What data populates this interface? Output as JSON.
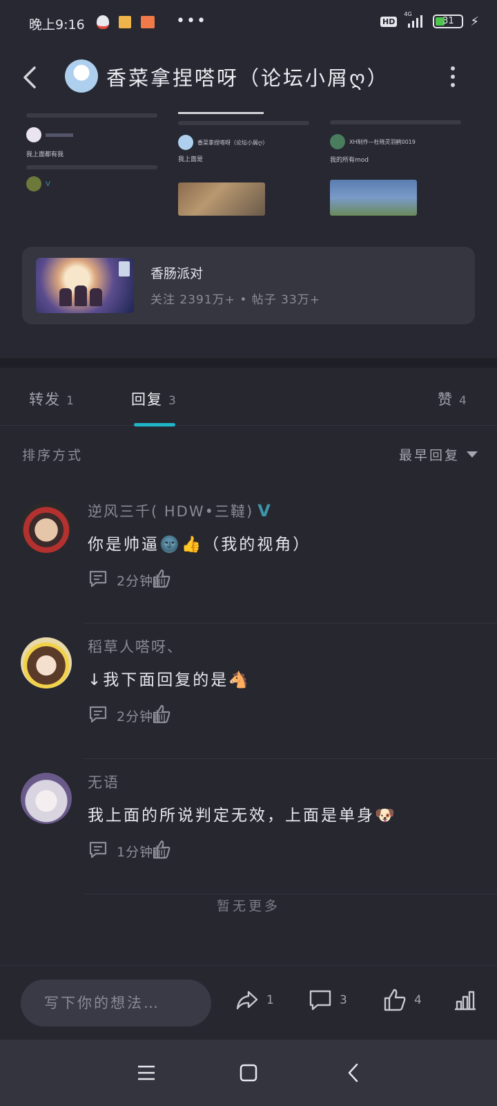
{
  "status_bar": {
    "time": "晚上9:16",
    "dots": "•••",
    "hd_label": "HD",
    "network": "4G",
    "battery": "31"
  },
  "header": {
    "title": "香菜拿捏嗒呀（论坛小屑ღ）"
  },
  "thumbnails": [
    {
      "caption": "我上面都有我",
      "username": ""
    },
    {
      "caption": "我上面是",
      "username": "香菜拿捏嗒呀（论坛小屑ღ）"
    },
    {
      "caption": "我的所有mod",
      "username": "XH制作—杜晓灵羽鹤0019"
    }
  ],
  "game_card": {
    "name": "香肠派对",
    "stats": "关注 2391万+ • 帖子 33万+"
  },
  "tabs": [
    {
      "label": "转发",
      "count": "1"
    },
    {
      "label": "回复",
      "count": "3"
    },
    {
      "label": "赞",
      "count": "4"
    }
  ],
  "sort": {
    "label": "排序方式",
    "value": "最早回复"
  },
  "replies": [
    {
      "username": "逆风三千( HDW•三韃)",
      "verified": "V",
      "content": "你是帅逼🌚👍（我的视角）",
      "time": "2分钟前"
    },
    {
      "username": "稻草人嗒呀、",
      "verified": "",
      "content": "↓我下面回复的是🐴",
      "time": "2分钟前"
    },
    {
      "username": "无语",
      "verified": "",
      "content": "我上面的所说判定无效，上面是单身🐶",
      "time": "1分钟前"
    }
  ],
  "no_more": "暂无更多",
  "bottom_bar": {
    "placeholder": "写下你的想法…",
    "forward_count": "1",
    "comment_count": "3",
    "like_count": "4"
  },
  "icons": {
    "back": "back-arrow-icon",
    "more": "more-vertical-icon",
    "comment": "comment-icon",
    "like": "thumbs-up-icon",
    "forward": "share-icon",
    "stats": "bar-chart-icon"
  },
  "colors": {
    "accent": "#1fb6c7",
    "background": "#26272f",
    "card": "#353640",
    "verified": "#3d95a9"
  }
}
